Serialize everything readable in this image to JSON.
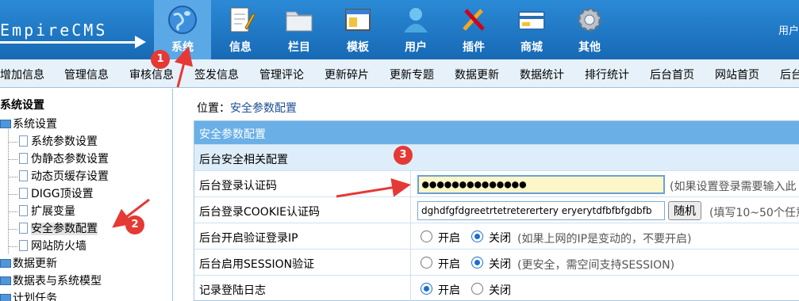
{
  "logo": "EmpireCMS",
  "user_label": "用户",
  "nav": [
    {
      "label": "系统",
      "icon": "globe-icon"
    },
    {
      "label": "信息",
      "icon": "notepad-icon"
    },
    {
      "label": "栏目",
      "icon": "folder-icon"
    },
    {
      "label": "模板",
      "icon": "window-icon"
    },
    {
      "label": "用户",
      "icon": "user-icon"
    },
    {
      "label": "插件",
      "icon": "tools-icon"
    },
    {
      "label": "商城",
      "icon": "card-icon"
    },
    {
      "label": "其他",
      "icon": "gear-icon"
    }
  ],
  "submenu": [
    "增加信息",
    "管理信息",
    "审核信息",
    "签发信息",
    "管理评论",
    "更新碎片",
    "更新专题",
    "数据更新",
    "数据统计",
    "排行统计",
    "后台首页",
    "网站首页",
    "后台"
  ],
  "tree": {
    "root": "系统设置",
    "group": "系统设置",
    "items": [
      "系统参数设置",
      "伪静态参数设置",
      "动态页缓存设置",
      "DIGG顶设置",
      "扩展变量",
      "安全参数配置",
      "网站防火墙"
    ],
    "more": [
      "数据更新",
      "数据表与系统模型",
      "计划任务"
    ]
  },
  "breadcrumb": {
    "prefix": "位置：",
    "current": "安全参数配置"
  },
  "panel": {
    "title": "安全参数配置",
    "section": "后台安全相关配置",
    "rows": {
      "auth_code": {
        "label": "后台登录认证码",
        "value": "●●●●●●●●●●●●●●",
        "hint": "(如果设置登录需要输入此"
      },
      "cookie_code": {
        "label": "后台登录COOKIE认证码",
        "value": "dghdfgfdgreetrtetreterertery eryerytdfbfbfgdbfb",
        "button": "随机",
        "hint": "(填写10~50个任意"
      },
      "login_ip": {
        "label": "后台开启验证登录IP",
        "on": "开启",
        "off": "关闭",
        "hint": "(如果上网的IP是变动的，不要开启)"
      },
      "session": {
        "label": "后台启用SESSION验证",
        "on": "开启",
        "off": "关闭",
        "hint": "(更安全，需空间支持SESSION)"
      },
      "log": {
        "label": "记录登陆日志",
        "on": "开启",
        "off": "关闭"
      }
    }
  },
  "annotations": [
    "1",
    "2",
    "3"
  ],
  "colors": {
    "header": "#1e7ac4",
    "active_tab": "#5aa8e6",
    "panel_head": "#6ab0e6",
    "annotation": "#e53935"
  }
}
